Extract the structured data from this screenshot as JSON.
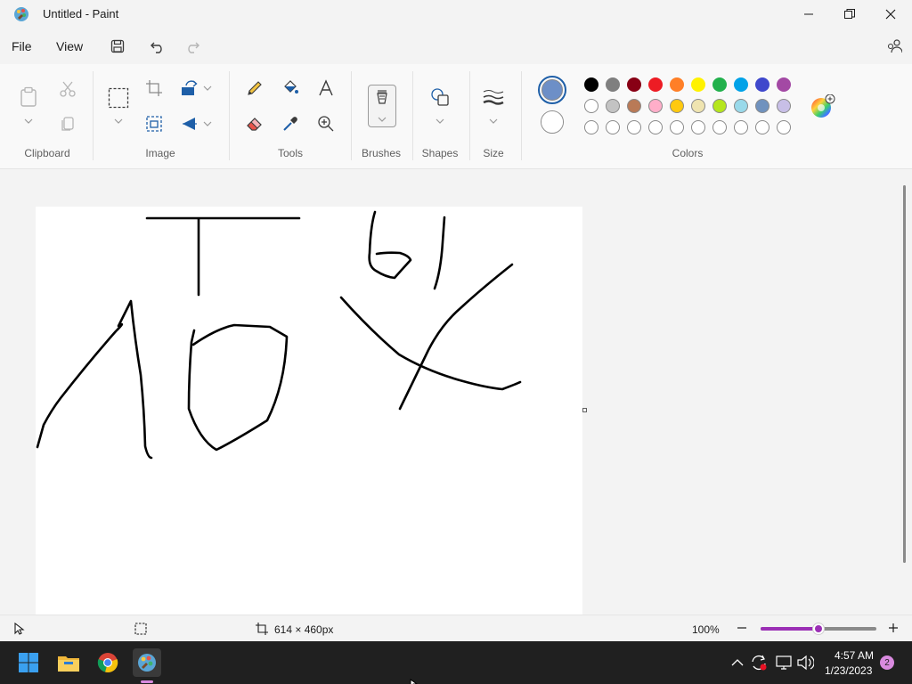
{
  "window": {
    "title": "Untitled - Paint"
  },
  "menu": {
    "file": "File",
    "view": "View"
  },
  "ribbon": {
    "groups": {
      "clipboard": "Clipboard",
      "image": "Image",
      "tools": "Tools",
      "brushes": "Brushes",
      "shapes": "Shapes",
      "size": "Size",
      "colors": "Colors"
    }
  },
  "colors": {
    "primary": "#6d8fc7",
    "secondary": "#ffffff",
    "palette_row1": [
      "#000000",
      "#7f7f7f",
      "#880015",
      "#ed1c24",
      "#ff7f27",
      "#fff200",
      "#22b14c",
      "#00a2e8",
      "#3f48cc",
      "#a349a4"
    ],
    "palette_row2": [
      "#ffffff",
      "#c3c3c3",
      "#b97a57",
      "#ffaec9",
      "#ffc90e",
      "#efe4b0",
      "#b5e61d",
      "#99d9ea",
      "#7092be",
      "#c8bfe7"
    ],
    "palette_row3": [
      "#ffffff",
      "#ffffff",
      "#ffffff",
      "#ffffff",
      "#ffffff",
      "#ffffff",
      "#ffffff",
      "#ffffff",
      "#ffffff",
      "#ffffff"
    ]
  },
  "status": {
    "canvas_size": "614 × 460px",
    "zoom": "100%",
    "zoom_fraction": 0.5
  },
  "taskbar": {
    "time": "4:57 AM",
    "date": "1/23/2023",
    "notification_count": "2"
  }
}
